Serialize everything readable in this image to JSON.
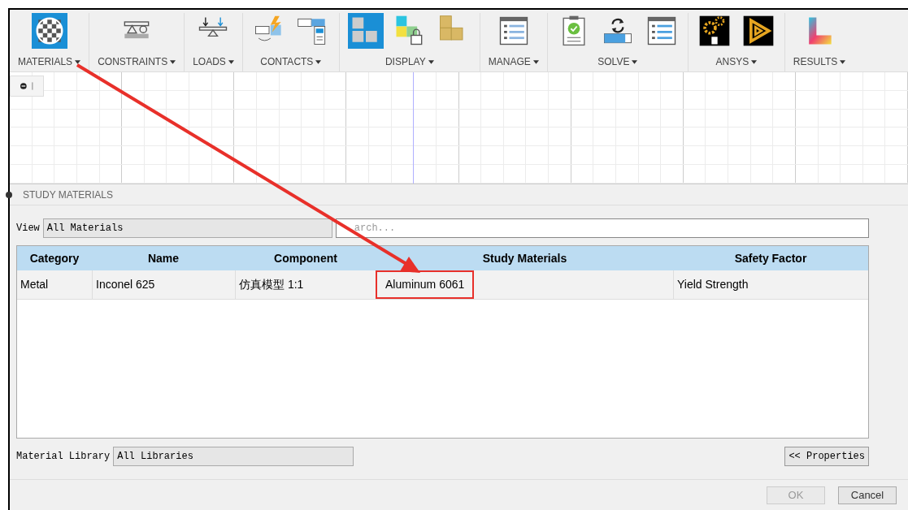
{
  "toolbar": [
    {
      "label": "MATERIALS",
      "icons": [
        {
          "kind": "checker-sphere",
          "active": true
        }
      ]
    },
    {
      "label": "CONSTRAINTS",
      "icons": [
        {
          "kind": "beam-support",
          "active": false
        }
      ]
    },
    {
      "label": "LOADS",
      "icons": [
        {
          "kind": "load-beam",
          "active": false
        }
      ]
    },
    {
      "label": "CONTACTS",
      "icons": [
        {
          "kind": "contact-bolt",
          "active": false
        },
        {
          "kind": "contact-panel",
          "active": false
        }
      ]
    },
    {
      "label": "DISPLAY",
      "icons": [
        {
          "kind": "tiles",
          "active": true
        },
        {
          "kind": "tiles-lock",
          "active": false
        },
        {
          "kind": "blocks",
          "active": false
        }
      ]
    },
    {
      "label": "MANAGE",
      "icons": [
        {
          "kind": "list-window",
          "active": false
        }
      ]
    },
    {
      "label": "SOLVE",
      "icons": [
        {
          "kind": "clipboard-check",
          "active": false
        },
        {
          "kind": "sync-bar",
          "active": false
        },
        {
          "kind": "list-window-blue",
          "active": false
        }
      ]
    },
    {
      "label": "ANSYS",
      "icons": [
        {
          "kind": "gears",
          "active": false
        },
        {
          "kind": "triangle-knot",
          "active": false
        }
      ]
    },
    {
      "label": "RESULTS",
      "icons": [
        {
          "kind": "result-shape",
          "active": false
        }
      ]
    }
  ],
  "panel": {
    "title": "STUDY MATERIALS",
    "view": {
      "label": "View",
      "value": "All Materials"
    },
    "search": {
      "placeholder": "arch..."
    },
    "table": {
      "columns": [
        "Category",
        "Name",
        "Component",
        "Study Materials",
        "Safety Factor"
      ],
      "rows": [
        {
          "cells": [
            {
              "text": "Metal",
              "highlighted": false
            },
            {
              "text": "Inconel 625",
              "highlighted": false
            },
            {
              "text": "仿真模型 1:1",
              "highlighted": false
            },
            {
              "text": "Aluminum 6061",
              "highlighted": true
            },
            {
              "text": "Yield Strength",
              "highlighted": false
            }
          ]
        }
      ]
    },
    "library": {
      "label": "Material Library",
      "value": "All Libraries"
    },
    "properties_button": "<< Properties",
    "buttons": [
      {
        "label": "OK",
        "disabled": true
      },
      {
        "label": "Cancel",
        "disabled": false
      }
    ]
  }
}
